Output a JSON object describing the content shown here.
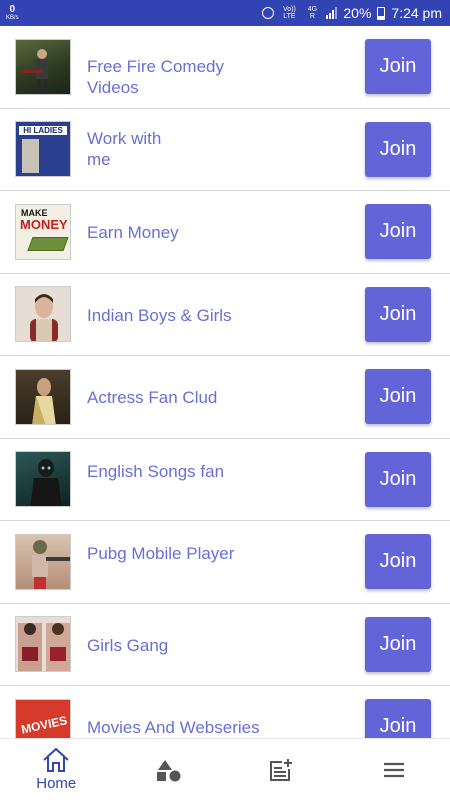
{
  "status_bar": {
    "data_rate": "0",
    "data_unit": "KB/s",
    "volte": "Vo)) LTE",
    "network": "4G R",
    "battery": "20%",
    "time": "7:24 pm"
  },
  "groups": [
    {
      "title": "Free Fire Comedy Videos",
      "button": "Join",
      "thumb_color": "#2e3a2a"
    },
    {
      "title": "Work with\n me",
      "button": "Join",
      "thumb_color": "#2b3f8f"
    },
    {
      "title": "Earn Money",
      "button": "Join",
      "thumb_color": "#e9e4c8"
    },
    {
      "title": "Indian Boys & Girls",
      "button": "Join",
      "thumb_color": "#d8cbc0"
    },
    {
      "title": "Actress Fan Clud",
      "button": "Join",
      "thumb_color": "#3c3326"
    },
    {
      "title": "English Songs fan",
      "button": "Join",
      "thumb_color": "#1f3a3a"
    },
    {
      "title": "Pubg Mobile Player",
      "button": "Join",
      "thumb_color": "#c7a48c"
    },
    {
      "title": "Girls Gang",
      "button": "Join",
      "thumb_color": "#a85a55"
    },
    {
      "title": "Movies And Webseries",
      "button": "Join",
      "thumb_color": "#d63a2a"
    }
  ],
  "thumb_texts": {
    "work": "HI LADIES",
    "earn_make": "MAKE",
    "earn_money": "MONEY",
    "movies": "MOVIES"
  },
  "bottom_nav": {
    "home_label": "Home",
    "accent": "#3247b0"
  },
  "colors": {
    "status_bar": "#3243b3",
    "title_text": "#6a6fd6",
    "join_button": "#6464d9"
  }
}
